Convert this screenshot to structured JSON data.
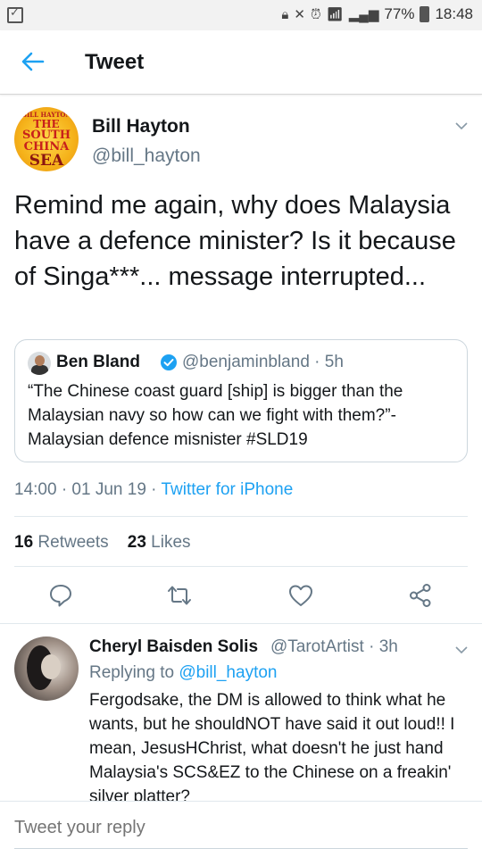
{
  "status_bar": {
    "battery": "77%",
    "time": "18:48"
  },
  "header": {
    "title": "Tweet"
  },
  "tweet": {
    "author_name": "Bill Hayton",
    "author_handle": "@bill_hayton",
    "avatar_text": [
      "BILL HAYTON",
      "THE",
      "SOUTH",
      "CHINA",
      "SEA"
    ],
    "text": "Remind me again, why does Malaysia have a defence minister? Is it because of Singa***... message interrupted...",
    "quote": {
      "author_name": "Ben Bland",
      "author_handle": "@benjaminbland · 5h",
      "text": "“The Chinese coast guard [ship] is bigger than the Malaysian navy so how can we fight with them?”-Malaysian defence misnister #SLD19"
    },
    "timestamp": "14:00 · 01 Jun 19 · ",
    "source": "Twitter for iPhone",
    "retweets_count": "16",
    "retweets_label": "Retweets",
    "likes_count": "23",
    "likes_label": "Likes"
  },
  "reply": {
    "author_name": "Cheryl Baisden Solis",
    "author_handle": "@TarotArtist · 3h",
    "replying_label": "Replying to ",
    "replying_handle": "@bill_hayton",
    "text": "Fergodsake, the DM is allowed to think what he wants, but he shouldNOT have said it out loud!! I mean, JesusHChrist, what doesn't he just hand Malaysia's SCS&EZ to the Chinese on a freakin' silver platter?"
  },
  "compose": {
    "placeholder": "Tweet your reply"
  },
  "colors": {
    "accent": "#1da1f2",
    "text": "#14171a",
    "muted": "#657786",
    "divider": "#e1e8ed"
  }
}
